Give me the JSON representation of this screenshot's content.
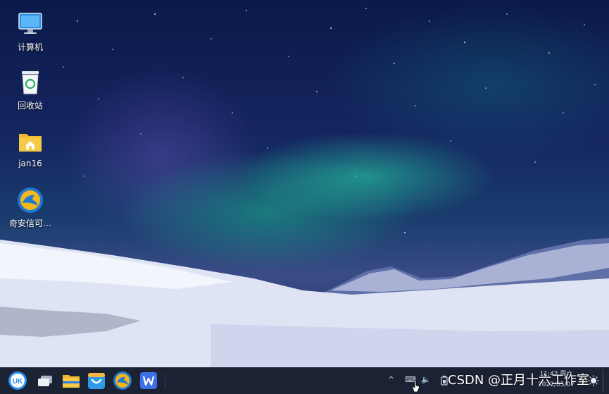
{
  "desktop": {
    "icons": [
      {
        "label": "计算机",
        "icon": "computer-icon"
      },
      {
        "label": "回收站",
        "icon": "recycle-bin-icon"
      },
      {
        "label": "jan16",
        "icon": "home-folder-icon"
      },
      {
        "label": "奇安信可…",
        "icon": "qianxin-browser-icon"
      }
    ]
  },
  "taskbar": {
    "apps": [
      {
        "name": "start-menu",
        "icon": "uk-start-icon"
      },
      {
        "name": "multitask-view",
        "icon": "window-switch-icon"
      },
      {
        "name": "file-manager",
        "icon": "folder-icon"
      },
      {
        "name": "software-store",
        "icon": "store-bag-icon"
      },
      {
        "name": "qianxin-browser",
        "icon": "browser-icon"
      },
      {
        "name": "wps-office",
        "icon": "wps-icon"
      }
    ],
    "tray": {
      "expand_glyph": "^",
      "keyboard_glyph": "⌨",
      "volume_glyph": "🔈"
    },
    "clock": {
      "time": "11:42 周六",
      "date": "2022/05/07"
    }
  },
  "overlay": {
    "watermark": "CSDN @正月十六工作室"
  },
  "colors": {
    "taskbar_bg": "#1b2233",
    "aurora": "#28dca8",
    "sky": "#14245e"
  }
}
